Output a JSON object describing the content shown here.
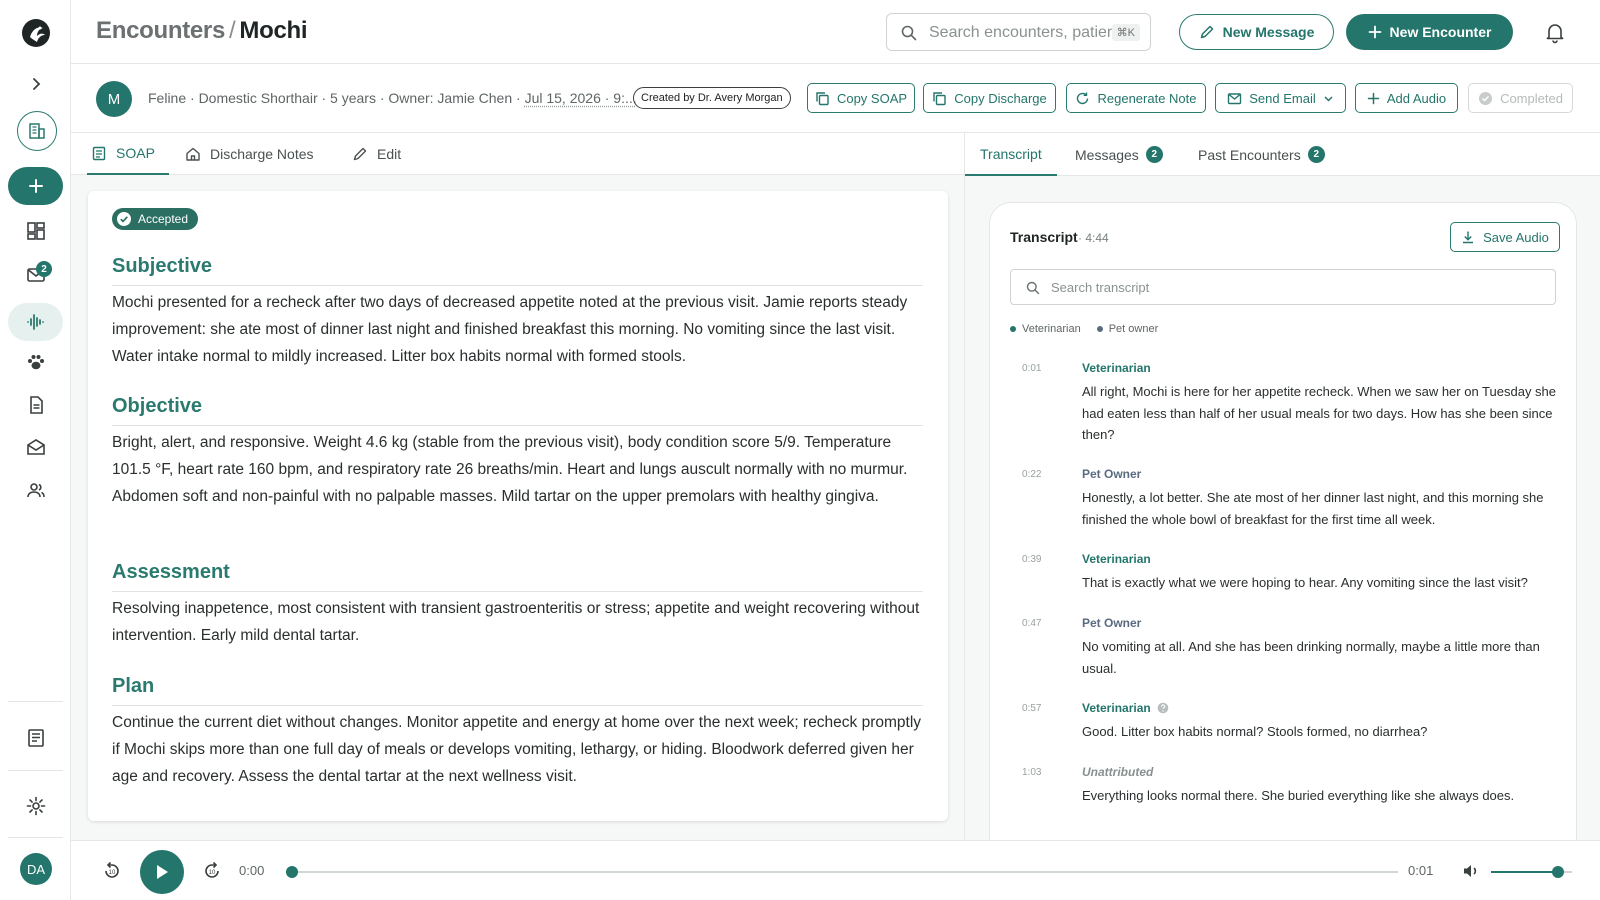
{
  "app": {
    "breadcrumb_parent": "Encounters",
    "breadcrumb_sep": "/",
    "breadcrumb_current": "Mochi"
  },
  "header": {
    "search_placeholder": "Search encounters, patien",
    "search_shortcut": "⌘K",
    "new_message_label": "New Message",
    "new_encounter_label": "New Encounter"
  },
  "rail": {
    "inbox_badge": "2",
    "user_initials": "DA"
  },
  "patient": {
    "initial": "M",
    "info_text": "Feline · Domestic Shorthair · 5 years · Owner: Jamie Chen ·",
    "date_text": "Jul 15, 2026 · 9:...",
    "created_by": "Created by Dr. Avery Morgan"
  },
  "actions": {
    "copy_soap": "Copy SOAP",
    "copy_discharge": "Copy Discharge",
    "regenerate": "Regenerate Note",
    "send_email": "Send Email",
    "add_audio": "Add Audio",
    "completed": "Completed"
  },
  "left_tabs": [
    {
      "label": "SOAP"
    },
    {
      "label": "Discharge Notes"
    },
    {
      "label": "Edit"
    }
  ],
  "soap": {
    "status": "Accepted",
    "sections": [
      {
        "heading": "Subjective",
        "body": "Mochi presented for a recheck after two days of decreased appetite noted at the previous visit. Jamie reports steady improvement: she ate most of dinner last night and finished breakfast this morning. No vomiting since the last visit. Water intake normal to mildly increased. Litter box habits normal with formed stools."
      },
      {
        "heading": "Objective",
        "body": "Bright, alert, and responsive. Weight 4.6 kg (stable from the previous visit), body condition score 5/9. Temperature 101.5 °F, heart rate 160 bpm, and respiratory rate 26 breaths/min. Heart and lungs auscult normally with no murmur. Abdomen soft and non-painful with no palpable masses. Mild tartar on the upper premolars with healthy gingiva."
      },
      {
        "heading": "Assessment",
        "body": "Resolving inappetence, most consistent with transient gastroenteritis or stress; appetite and weight recovering without intervention. Early mild dental tartar."
      },
      {
        "heading": "Plan",
        "body": "Continue the current diet without changes. Monitor appetite and energy at home over the next week; recheck promptly if Mochi skips more than one full day of meals or develops vomiting, lethargy, or hiding. Bloodwork deferred given her age and recovery. Assess the dental tartar at the next wellness visit."
      }
    ]
  },
  "right_tabs": [
    {
      "label": "Transcript"
    },
    {
      "label": "Messages",
      "count": "2"
    },
    {
      "label": "Past Encounters",
      "count": "2"
    }
  ],
  "transcript": {
    "title": "Transcript",
    "duration": "· 4:44",
    "save_audio": "Save Audio",
    "search_placeholder": "Search transcript",
    "legend": [
      {
        "label": "Veterinarian",
        "color": "#24756b"
      },
      {
        "label": "Pet owner",
        "color": "#5a6a80"
      }
    ],
    "utterances": [
      {
        "time": "0:01",
        "speaker": "Veterinarian",
        "text": "All right, Mochi is here for her appetite recheck. When we saw her on Tuesday she had eaten less than half of her usual meals for two days. How has she been since then?"
      },
      {
        "time": "0:22",
        "speaker": "Pet Owner",
        "text": "Honestly, a lot better. She ate most of her dinner last night, and this morning she finished the whole bowl of breakfast for the first time all week."
      },
      {
        "time": "0:39",
        "speaker": "Veterinarian",
        "text": "That is exactly what we were hoping to hear. Any vomiting since the last visit?"
      },
      {
        "time": "0:47",
        "speaker": "Pet Owner",
        "text": "No vomiting at all. And she has been drinking normally, maybe a little more than usual."
      },
      {
        "time": "0:57",
        "speaker": "Veterinarian",
        "text": "Good. Litter box habits normal? Stools formed, no diarrhea?"
      },
      {
        "time": "1:03",
        "speaker": "Unattributed",
        "text": "Everything looks normal there. She buried everything like she always does."
      }
    ]
  },
  "player": {
    "current_time": "0:00",
    "total_time": "0:01",
    "progress_fraction": 0,
    "volume_fraction": 0.83
  },
  "colors": {
    "accent": "#24756b",
    "owner": "#5a6a80"
  }
}
